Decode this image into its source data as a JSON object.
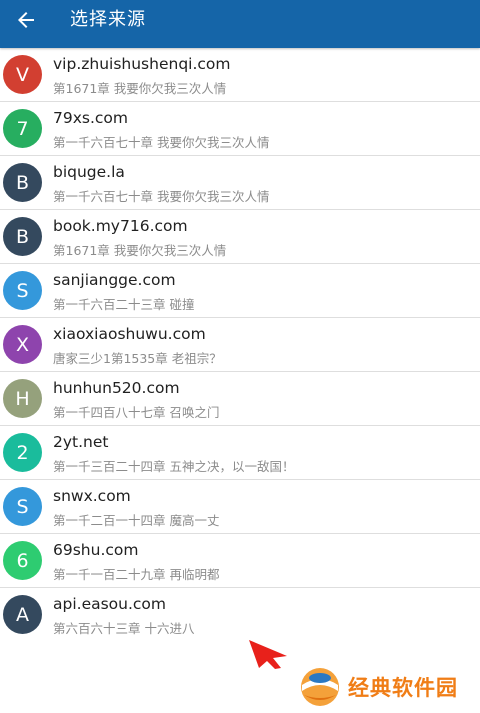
{
  "header": {
    "title": "选择来源",
    "back_icon": "arrow-left-icon",
    "background": "#1565a8"
  },
  "sources": [
    {
      "initial": "V",
      "title": "vip.zhuishushenqi.com",
      "subtitle": "第1671章 我要你欠我三次人情",
      "color": "#d23f31"
    },
    {
      "initial": "7",
      "title": "79xs.com",
      "subtitle": "第一千六百七十章 我要你欠我三次人情",
      "color": "#27ae60"
    },
    {
      "initial": "B",
      "title": "biquge.la",
      "subtitle": "第一千六百七十章 我要你欠我三次人情",
      "color": "#34495e"
    },
    {
      "initial": "B",
      "title": "book.my716.com",
      "subtitle": "第1671章 我要你欠我三次人情",
      "color": "#34495e"
    },
    {
      "initial": "S",
      "title": "sanjiangge.com",
      "subtitle": "第一千六百二十三章 碰撞",
      "color": "#3498db"
    },
    {
      "initial": "X",
      "title": "xiaoxiaoshuwu.com",
      "subtitle": "唐家三少1第1535章 老祖宗？",
      "color": "#8e44ad"
    },
    {
      "initial": "H",
      "title": "hunhun520.com",
      "subtitle": "第一千四百八十七章 召唤之门",
      "color": "#95a17c"
    },
    {
      "initial": "2",
      "title": "2yt.net",
      "subtitle": "第一千三百二十四章 五神之决，以一敌国！",
      "color": "#1abc9c"
    },
    {
      "initial": "S",
      "title": "snwx.com",
      "subtitle": "第一千二百一十四章 魔高一丈",
      "color": "#3498db"
    },
    {
      "initial": "6",
      "title": "69shu.com",
      "subtitle": "第一千一百二十九章 再临明都",
      "color": "#2ecc71"
    },
    {
      "initial": "A",
      "title": "api.easou.com",
      "subtitle": "第六百六十三章 十六进八",
      "color": "#34495e"
    }
  ],
  "watermark": {
    "text": "经典软件园",
    "icon": "globe-logo-icon",
    "color": "#f07d16"
  },
  "pointer": {
    "icon": "red-pointer-arrow-icon",
    "color": "#e8211b"
  }
}
